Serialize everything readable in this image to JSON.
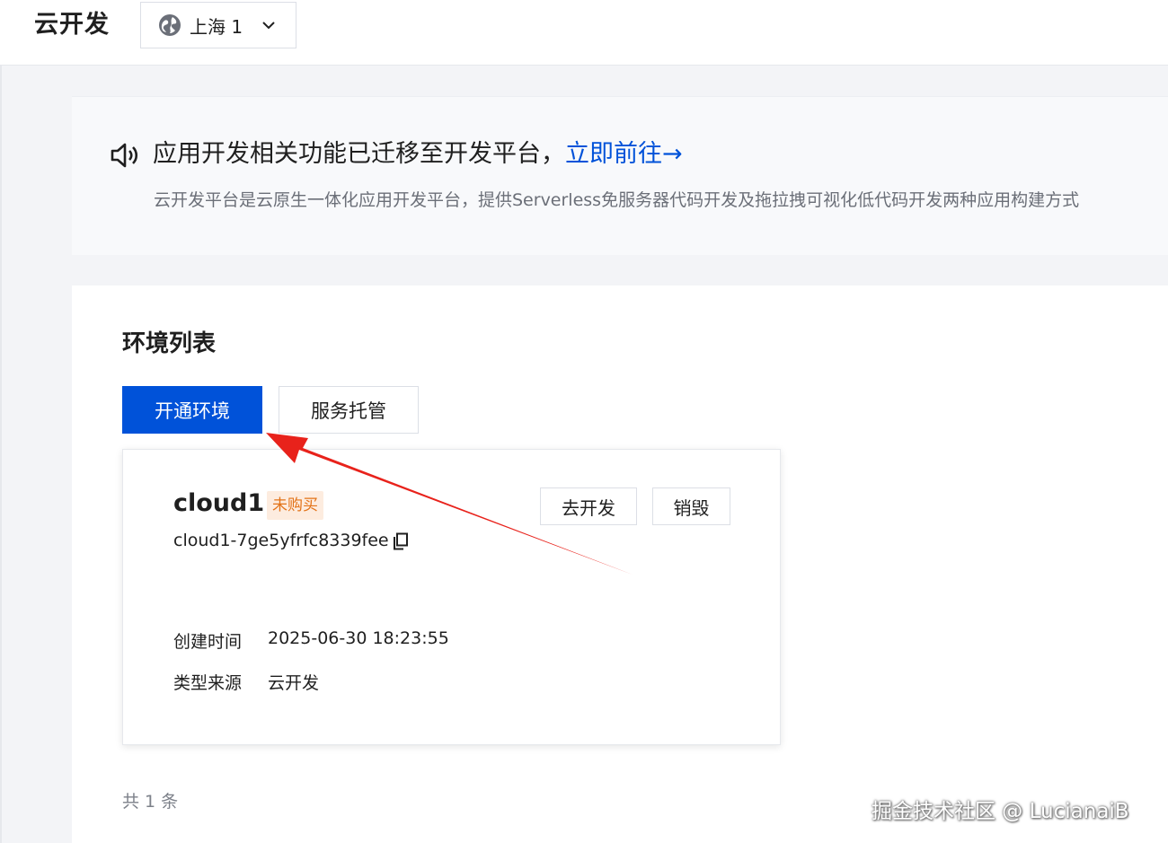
{
  "header": {
    "brand": "云开发",
    "region": {
      "label": "上海 1",
      "icon": "globe-icon",
      "dropdown_icon": "chevron-down-icon"
    }
  },
  "notice": {
    "icon": "speaker-icon",
    "headline": "应用开发相关功能已迁移至开发平台，",
    "link_label": "立即前往→",
    "description": "云开发平台是云原生一体化应用开发平台，提供Serverless免服务器代码开发及拖拉拽可视化低代码开发两种应用构建方式"
  },
  "env_list": {
    "title": "环境列表",
    "primary_button": "开通环境",
    "secondary_button": "服务托管",
    "items": [
      {
        "name": "cloud1",
        "status": "未购买",
        "env_id": "cloud1-7ge5yfrfc8339fee",
        "actions": [
          "去开发",
          "销毁"
        ],
        "meta": [
          {
            "label": "创建时间",
            "value": "2025-06-30 18:23:55"
          },
          {
            "label": "类型来源",
            "value": "云开发"
          }
        ]
      }
    ],
    "total": "共 1 条"
  },
  "annotation": {
    "type": "red-arrow",
    "color": "#e8221b"
  },
  "watermark": "掘金技术社区 @ LucianaiB",
  "colors": {
    "primary": "#0052d9",
    "badge_bg": "#fdecdf",
    "badge_text": "#e37318",
    "page_bg": "#f3f4f7"
  }
}
